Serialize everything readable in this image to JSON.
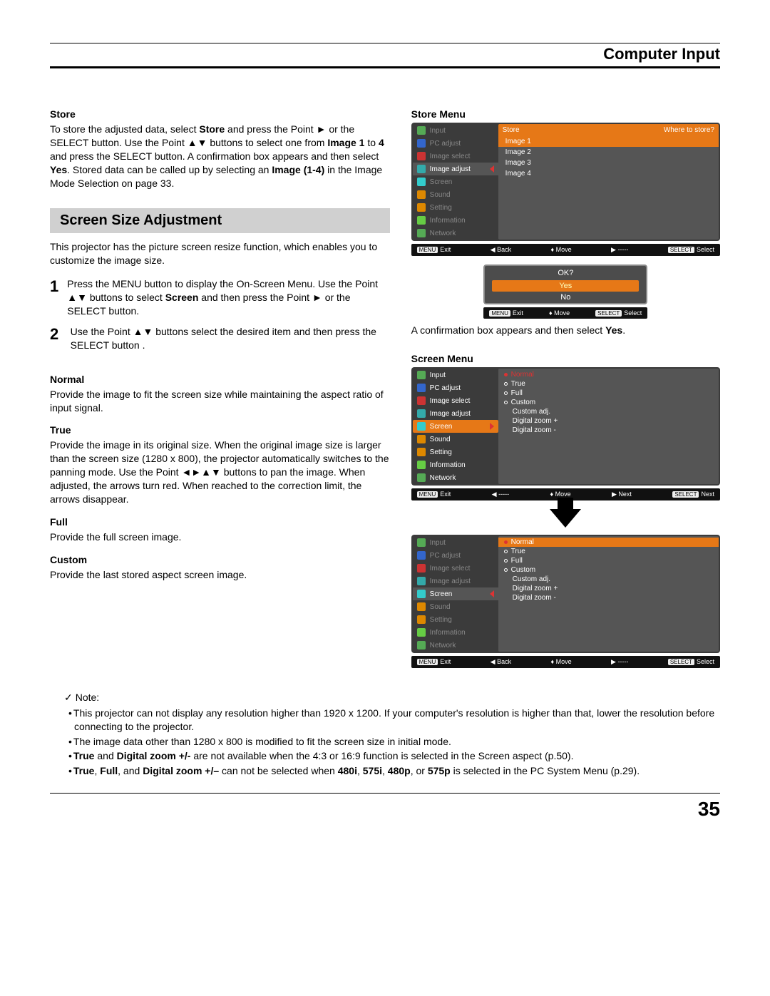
{
  "header": {
    "title": "Computer Input"
  },
  "store": {
    "heading": "Store",
    "body_html": "To store the adjusted data, select <b>Store</b> and press the Point ► or the SELECT button. Use the Point ▲▼ buttons to select one from <b>Image 1</b> to <b>4</b> and press the SELECT button. A confirmation box appears and then select <b>Yes</b>. Stored data can be called up by selecting an <b>Image (1-4)</b> in the Image Mode Selection on page 33."
  },
  "screen_section": {
    "bar": "Screen Size Adjustment",
    "intro": "This projector has the picture screen resize function, which enables you to customize the image size.",
    "steps": [
      {
        "n": "1",
        "txt_html": "Press the MENU button to display the On-Screen Menu. Use the Point ▲▼ buttons to select <b>Screen</b> and then press the Point ► or the SELECT button."
      },
      {
        "n": "2",
        "txt_html": "Use the Point ▲▼ buttons select the desired item and then press the SELECT button ."
      }
    ],
    "modes": [
      {
        "h": "Normal",
        "p": "Provide the image to fit the screen size while maintaining the aspect ratio of input signal."
      },
      {
        "h": "True",
        "p": "Provide the image in its original size. When the original image size is larger than the screen size (1280 x 800), the projector automatically switches to the panning mode. Use the Point ◄►▲▼ buttons to pan the image. When adjusted, the arrows turn red. When reached to the correction limit, the arrows disappear."
      },
      {
        "h": "Full",
        "p": "Provide the full screen image."
      },
      {
        "h": "Custom",
        "p": "Provide the last stored aspect screen image."
      }
    ]
  },
  "right": {
    "store_menu_h": "Store Menu",
    "menu_items": [
      "Input",
      "PC adjust",
      "Image select",
      "Image adjust",
      "Screen",
      "Sound",
      "Setting",
      "Information",
      "Network"
    ],
    "store_header": "Store",
    "store_header_r": "Where to store?",
    "store_options": [
      "Image 1",
      "Image 2",
      "Image 3",
      "Image 4"
    ],
    "footer1": {
      "a": "MENU Exit",
      "b": "◀ Back",
      "c": "♦ Move",
      "d": "▶ -----",
      "e": "SELECT Select"
    },
    "confirm": {
      "q": "OK?",
      "yes": "Yes",
      "no": "No"
    },
    "confirm_footer": {
      "a": "MENU Exit",
      "b": "♦ Move",
      "c": "SELECT Select"
    },
    "confirm_caption_html": "A confirmation box appears and then select <b>Yes</b>.",
    "screen_menu_h": "Screen Menu",
    "screen_options": [
      "Normal",
      "True",
      "Full",
      "Custom",
      "Custom adj.",
      "Digital zoom +",
      "Digital zoom -"
    ],
    "footer2": {
      "a": "MENU Exit",
      "b": "◀ -----",
      "c": "♦ Move",
      "d": "▶ Next",
      "e": "SELECT Next"
    },
    "footer3": {
      "a": "MENU Exit",
      "b": "◀ Back",
      "c": "♦ Move",
      "d": "▶ -----",
      "e": "SELECT Select"
    }
  },
  "notes": {
    "hdr": "Note:",
    "items_html": [
      "This projector can not display any resolution higher than 1920 x 1200. If your computer's resolution is higher than that, lower the resolution before connecting to the projector.",
      "The image data other than 1280 x 800 is modified to fit the screen size in initial mode.",
      "<b>True</b> and <b>Digital zoom +/-</b> are not available when the 4:3 or 16:9 function is selected in the Screen aspect (p.50).",
      "<b>True</b>, <b>Full</b>, and <b>Digital zoom +/–</b> can not be selected when <b>480i</b>, <b>575i</b>, <b>480p</b>, or <b>575p</b> is selected in the PC System Menu (p.29)."
    ]
  },
  "page_number": "35"
}
